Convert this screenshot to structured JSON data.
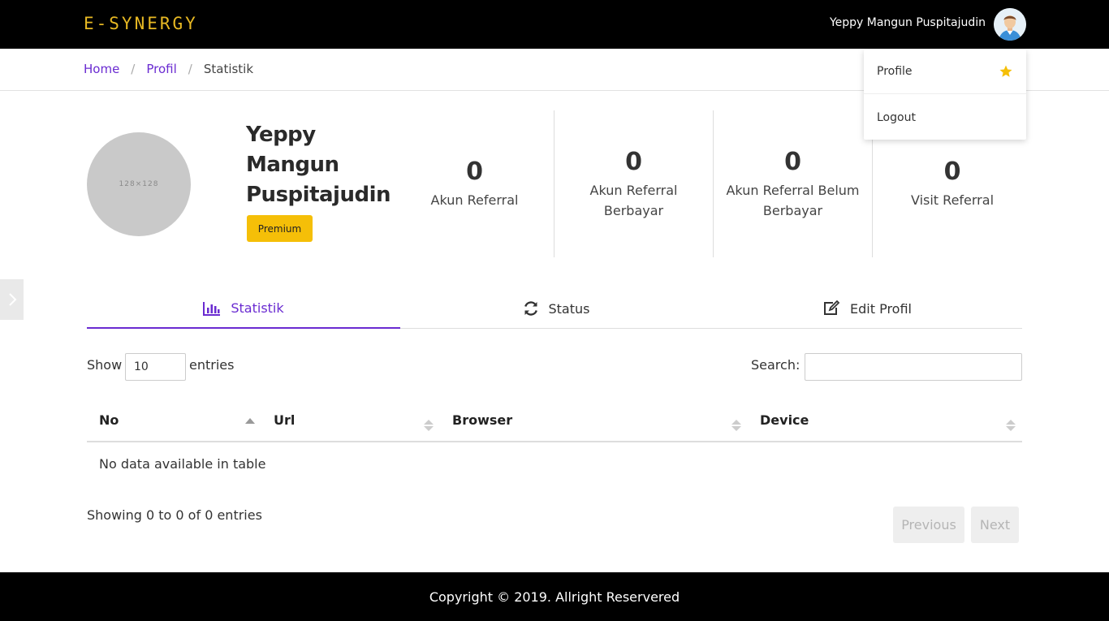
{
  "header": {
    "brand": "E-SYNERGY",
    "user_name": "Yeppy Mangun Puspitajudin",
    "avatar_icon": "user-avatar-icon"
  },
  "breadcrumb": {
    "items": [
      "Home",
      "Profil"
    ],
    "current": "Statistik",
    "separator": "/"
  },
  "user_menu": {
    "items": [
      {
        "label": "Profile",
        "icon": "star-icon"
      },
      {
        "label": "Logout"
      }
    ]
  },
  "profile": {
    "photo_placeholder": "128×128",
    "name_lines": [
      "Yeppy",
      "Mangun",
      "Puspitajudin"
    ],
    "badge": "Premium"
  },
  "stats": [
    {
      "value": "0",
      "label_lines": [
        "Akun Referral"
      ]
    },
    {
      "value": "0",
      "label_lines": [
        "Akun Referral",
        "Berbayar"
      ]
    },
    {
      "value": "0",
      "label_lines": [
        "Akun Referral Belum",
        "Berbayar"
      ]
    },
    {
      "value": "0",
      "label_lines": [
        "Visit Referral"
      ]
    }
  ],
  "tabs": [
    {
      "label": "Statistik",
      "icon": "bar-chart-icon",
      "active": true
    },
    {
      "label": "Status",
      "icon": "refresh-icon",
      "active": false
    },
    {
      "label": "Edit Profil",
      "icon": "edit-icon",
      "active": false
    }
  ],
  "table_controls": {
    "show_label": "Show",
    "entries_value": "10",
    "entries_label": "entries",
    "search_label": "Search:",
    "search_value": ""
  },
  "table": {
    "columns": [
      "No",
      "Url",
      "Browser",
      "Device"
    ],
    "empty_message": "No data available in table"
  },
  "pagination": {
    "info": "Showing 0 to 0 of 0 entries",
    "previous": "Previous",
    "next": "Next"
  },
  "footer": {
    "copyright": "Copyright © 2019. Allright Reservered"
  },
  "colors": {
    "brand_gold": "#e8b923",
    "accent_purple": "#6a2bd1",
    "badge_yellow": "#f5bf08",
    "star_yellow": "#f5bf08"
  }
}
